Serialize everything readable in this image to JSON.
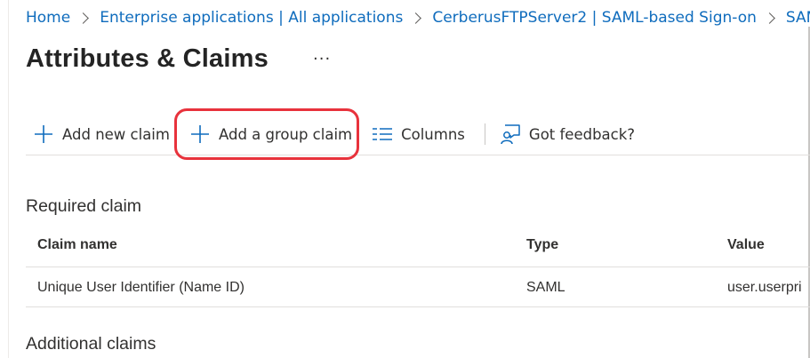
{
  "breadcrumb": {
    "items": [
      "Home",
      "Enterprise applications | All applications",
      "CerberusFTPServer2 | SAML-based Sign-on",
      "SAM"
    ]
  },
  "page": {
    "title": "Attributes & Claims",
    "more_label": "···"
  },
  "toolbar": {
    "add_claim": "Add new claim",
    "add_group_claim": "Add a group claim",
    "columns": "Columns",
    "feedback": "Got feedback?"
  },
  "required": {
    "title": "Required claim",
    "columns": [
      "Claim name",
      "Type",
      "Value"
    ],
    "rows": [
      [
        "Unique User Identifier (Name ID)",
        "SAML",
        "user.userpri"
      ]
    ]
  },
  "additional": {
    "title": "Additional claims"
  },
  "colors": {
    "link": "#0f6cbd",
    "highlight": "#e8323c"
  }
}
